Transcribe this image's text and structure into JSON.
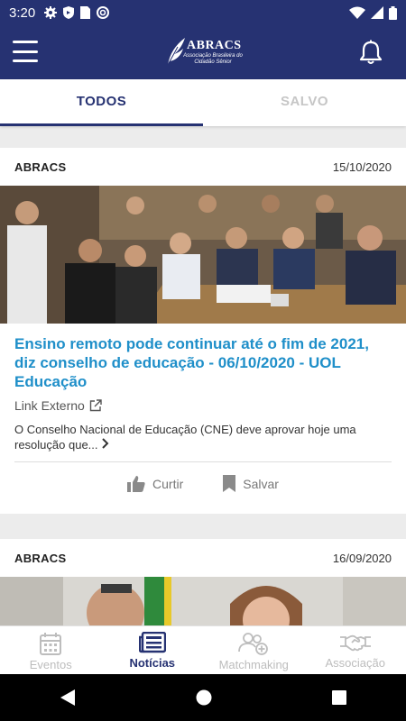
{
  "status_bar": {
    "time": "3:20"
  },
  "app": {
    "logo_text": "ABRACS",
    "logo_subtitle": "Associação Brasileira do Cidadão Sênior"
  },
  "tabs": [
    {
      "label": "TODOS",
      "active": true
    },
    {
      "label": "SALVO",
      "active": false
    }
  ],
  "news": [
    {
      "source": "ABRACS",
      "date": "15/10/2020",
      "title": "Ensino remoto pode continuar até o fim de 2021, diz conselho de educação - 06/10/2020 - UOL Educação",
      "link_label": "Link Externo",
      "summary": "O Conselho Nacional de Educação (CNE) deve aprovar hoje uma resolução que...",
      "like_label": "Curtir",
      "save_label": "Salvar"
    },
    {
      "source": "ABRACS",
      "date": "16/09/2020"
    }
  ],
  "bottom_nav": [
    {
      "label": "Eventos",
      "icon": "calendar-icon",
      "active": false
    },
    {
      "label": "Notícias",
      "icon": "news-icon",
      "active": true
    },
    {
      "label": "Matchmaking",
      "icon": "people-add-icon",
      "active": false
    },
    {
      "label": "Associação",
      "icon": "handshake-icon",
      "active": false
    }
  ],
  "colors": {
    "primary": "#263272",
    "title_blue": "#1f8fc9",
    "inactive_gray": "#bdbdbd"
  }
}
